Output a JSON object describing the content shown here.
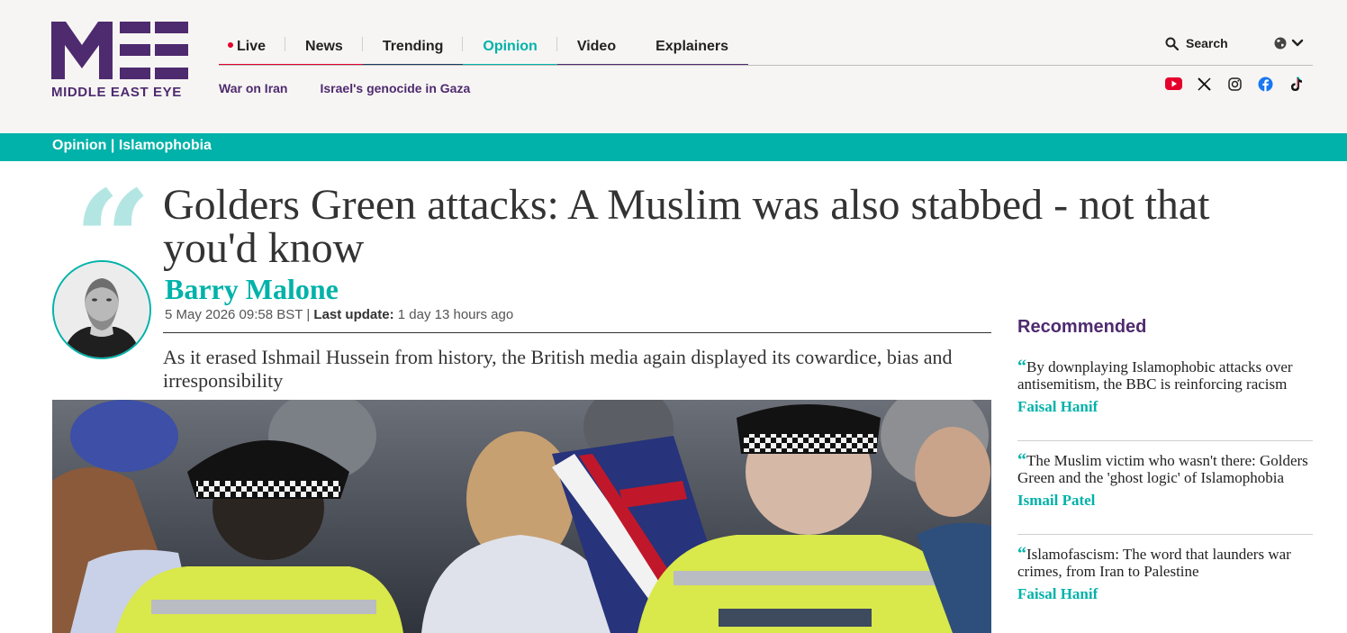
{
  "brand": {
    "logo_text": "MIDDLE EAST EYE",
    "accent": "#00b2a9",
    "brand_purple": "#4e2a6f"
  },
  "nav": {
    "items": [
      {
        "label": "Live",
        "bar_color": "#e4002b"
      },
      {
        "label": "News",
        "bar_color": "#e4002b"
      },
      {
        "label": "Trending",
        "bar_color": "#1c3a5e"
      },
      {
        "label": "Opinion",
        "bar_color": "#00b2a9"
      },
      {
        "label": "Video",
        "bar_color": "#4e2a6f"
      },
      {
        "label": "Explainers",
        "bar_color": "#4e2a6f"
      }
    ],
    "sub": [
      "War on Iran",
      "Israel's genocide in Gaza"
    ],
    "search_label": "Search"
  },
  "socials": [
    "youtube-icon",
    "x-icon",
    "instagram-icon",
    "facebook-icon",
    "tiktok-icon"
  ],
  "breadcrumb": {
    "section": "Opinion",
    "separator": "|",
    "topic": "Islamophobia"
  },
  "article": {
    "headline": "Golders Green attacks: A Muslim was also stabbed - not that you'd know",
    "author": "Barry Malone",
    "published": "5 May 2026 09:58 BST",
    "last_update_label": "Last update:",
    "last_update": "1 day 13 hours ago",
    "standfirst": "As it erased Ishmail Hussein from history, the British media again displayed its cowardice, bias and irresponsibility"
  },
  "recommended": {
    "title": "Recommended",
    "items": [
      {
        "headline": "By downplaying Islamophobic attacks over antisemitism, the BBC is reinforcing racism",
        "author": "Faisal Hanif"
      },
      {
        "headline": "The Muslim victim who wasn't there: Golders Green and the 'ghost logic' of Islamophobia",
        "author": "Ismail Patel"
      },
      {
        "headline": "Islamofascism: The word that launders war crimes, from Iran to Palestine",
        "author": "Faisal Hanif"
      }
    ]
  }
}
